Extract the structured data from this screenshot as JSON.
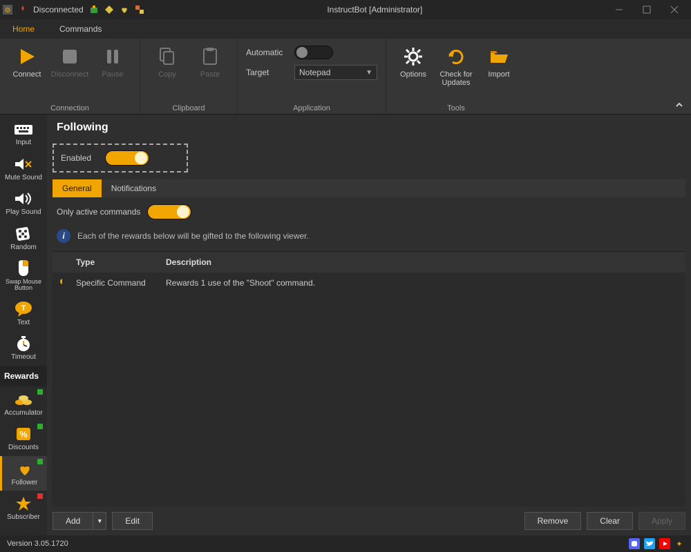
{
  "titlebar": {
    "status": "Disconnected",
    "title": "InstructBot [Administrator]"
  },
  "menubar": {
    "home": "Home",
    "commands": "Commands"
  },
  "ribbon": {
    "connection": {
      "label": "Connection",
      "connect": "Connect",
      "disconnect": "Disconnect",
      "pause": "Pause"
    },
    "clipboard": {
      "label": "Clipboard",
      "copy": "Copy",
      "paste": "Paste"
    },
    "application": {
      "label": "Application",
      "automatic": "Automatic",
      "target": "Target",
      "target_value": "Notepad"
    },
    "tools": {
      "label": "Tools",
      "options": "Options",
      "check_updates": "Check for Updates",
      "import": "Import"
    }
  },
  "sidebar": {
    "items": [
      {
        "label": "Input"
      },
      {
        "label": "Mute Sound"
      },
      {
        "label": "Play Sound"
      },
      {
        "label": "Random"
      },
      {
        "label": "Swap Mouse Button"
      },
      {
        "label": "Text"
      },
      {
        "label": "Timeout"
      }
    ],
    "rewards_header": "Rewards",
    "rewards": [
      {
        "label": "Accumulator",
        "indicator": "green"
      },
      {
        "label": "Discounts",
        "indicator": "green"
      },
      {
        "label": "Follower",
        "indicator": "green"
      },
      {
        "label": "Subscriber",
        "indicator": "red"
      }
    ]
  },
  "page": {
    "title": "Following",
    "enabled_label": "Enabled",
    "tabs": {
      "general": "General",
      "notifications": "Notifications"
    },
    "only_active": "Only active commands",
    "info": "Each of the rewards below will be gifted to the following viewer.",
    "grid": {
      "headers": {
        "type": "Type",
        "description": "Description"
      },
      "rows": [
        {
          "type": "Specific Command",
          "description": "Rewards 1 use of the \"Shoot\" command."
        }
      ]
    },
    "buttons": {
      "add": "Add",
      "edit": "Edit",
      "remove": "Remove",
      "clear": "Clear",
      "apply": "Apply"
    }
  },
  "statusbar": {
    "version": "Version 3.05.1720"
  }
}
